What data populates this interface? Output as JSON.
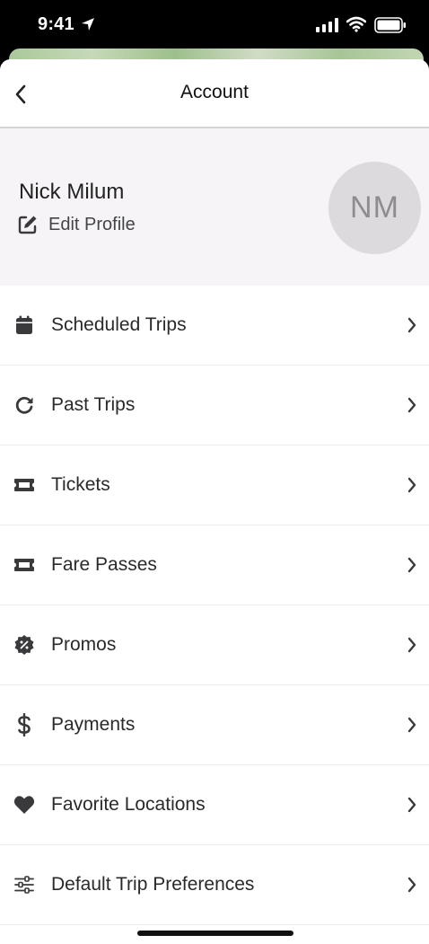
{
  "status_bar": {
    "time": "9:41"
  },
  "nav": {
    "title": "Account"
  },
  "profile": {
    "name": "Nick Milum",
    "edit_label": "Edit Profile",
    "initials": "NM"
  },
  "menu": {
    "items": [
      {
        "label": "Scheduled Trips",
        "icon": "calendar-icon"
      },
      {
        "label": "Past Trips",
        "icon": "history-icon"
      },
      {
        "label": "Tickets",
        "icon": "ticket-icon"
      },
      {
        "label": "Fare Passes",
        "icon": "ticket-icon"
      },
      {
        "label": "Promos",
        "icon": "promo-badge-icon"
      },
      {
        "label": "Payments",
        "icon": "dollar-icon"
      },
      {
        "label": "Favorite Locations",
        "icon": "heart-icon"
      },
      {
        "label": "Default Trip Preferences",
        "icon": "sliders-icon"
      }
    ]
  },
  "colors": {
    "profile_background": "#f6f4f7",
    "avatar_background": "#dcdadd",
    "icon_color": "#3a3a3c"
  }
}
